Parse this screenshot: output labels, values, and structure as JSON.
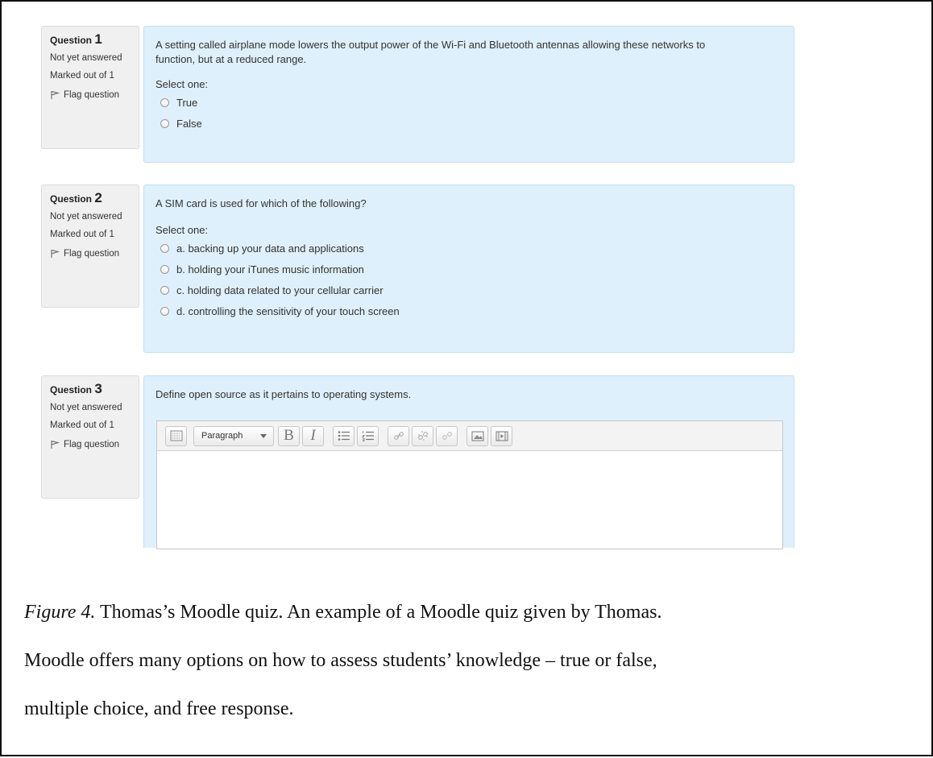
{
  "questions": [
    {
      "label": "Question",
      "number": "1",
      "status": "Not yet answered",
      "marked": "Marked out of 1",
      "flag_label": "Flag question",
      "text": "A setting called airplane mode lowers the output power of the Wi-Fi and Bluetooth antennas allowing these networks to function, but at a reduced range.",
      "select_label": "Select one:",
      "options": [
        "True",
        "False"
      ]
    },
    {
      "label": "Question",
      "number": "2",
      "status": "Not yet answered",
      "marked": "Marked out of 1",
      "flag_label": "Flag question",
      "text": "A SIM card is used for which of the following?",
      "select_label": "Select one:",
      "options": [
        "a. backing up your data and applications",
        "b. holding your iTunes music information",
        "c. holding data related to your cellular carrier",
        "d. controlling the sensitivity of your touch screen"
      ]
    },
    {
      "label": "Question",
      "number": "3",
      "status": "Not yet answered",
      "marked": "Marked out of 1",
      "flag_label": "Flag question",
      "text": "Define open source as it pertains to operating systems.",
      "editor": {
        "format_select": "Paragraph",
        "bold": "B",
        "italic": "I"
      }
    }
  ],
  "caption": {
    "figure_label": "Figure 4.",
    "line1_rest": "Thomas’s Moodle quiz. An example of a Moodle quiz given by Thomas.",
    "line2": "Moodle offers many options on how to assess students’ knowledge – true or false,",
    "line3": "multiple choice, and free response."
  },
  "colors": {
    "content_bg": "#def0fb",
    "info_bg": "#f0f0f0"
  }
}
